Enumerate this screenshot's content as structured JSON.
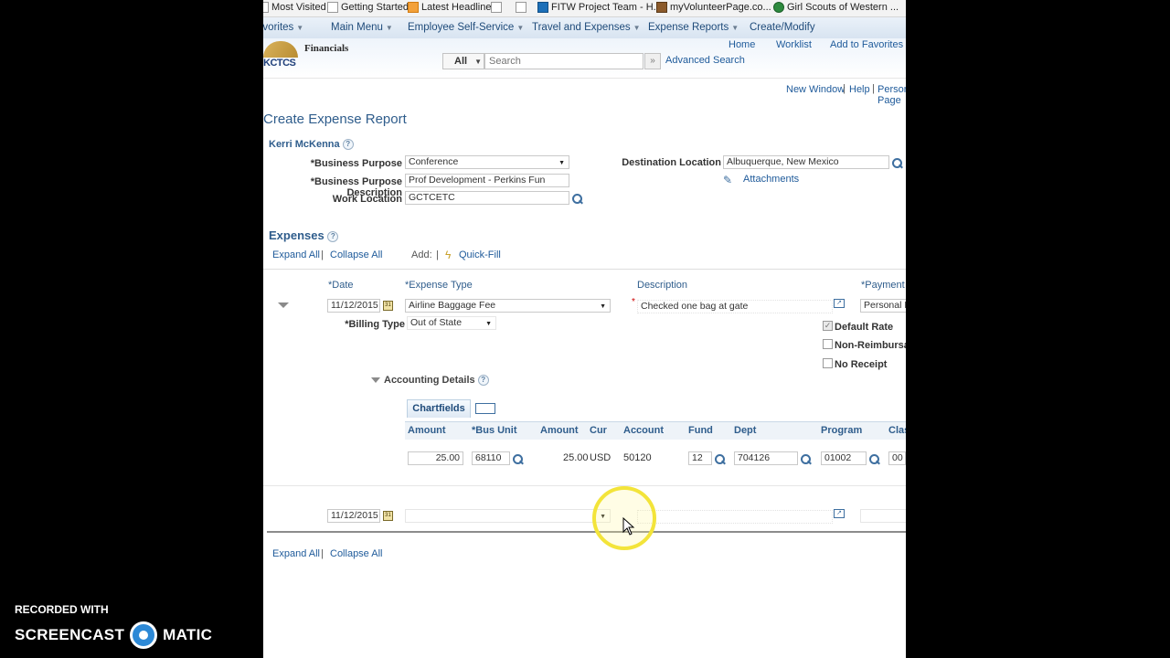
{
  "favorites_bar": [
    {
      "label": "Most Visited",
      "icon": "bookmark-icon"
    },
    {
      "label": "Getting Started",
      "icon": "page-icon"
    },
    {
      "label": "Latest Headlines",
      "icon": "rss-icon"
    },
    {
      "label": "",
      "icon": "page-icon"
    },
    {
      "label": "",
      "icon": "page-icon"
    },
    {
      "label": "FITW Project Team - H...",
      "icon": "sharepoint-icon"
    },
    {
      "label": "myVolunteerPage.co...",
      "icon": "site-icon"
    },
    {
      "label": "Girl Scouts of Western ...",
      "icon": "trefoil-icon"
    }
  ],
  "nav": {
    "favorites": "Favorites",
    "main_menu": "Main Menu",
    "self_service": "Employee Self-Service",
    "travel": "Travel and Expenses",
    "expense_reports": "Expense Reports",
    "create_modify": "Create/Modify"
  },
  "header": {
    "logo_text": "KCTCS",
    "app_name": "Financials",
    "home": "Home",
    "worklist": "Worklist",
    "add_favorites": "Add to Favorites",
    "search_scope": "All",
    "search_placeholder": "Search",
    "advanced_search": "Advanced Search"
  },
  "toolbar": {
    "new_window": "New Window",
    "help": "Help",
    "personalize": "Personalize Page"
  },
  "page": {
    "title": "Create Expense Report",
    "employee": "Kerri McKenna"
  },
  "form": {
    "business_purpose_label": "*Business Purpose",
    "business_purpose": "Conference",
    "description_label": "*Business Purpose Description",
    "description": "Prof Development - Perkins Fun",
    "work_location_label": "Work Location",
    "work_location": "GCTCETC",
    "destination_label": "Destination Location",
    "destination": "Albuquerque, New Mexico",
    "attachments": "Attachments"
  },
  "expenses": {
    "heading": "Expenses",
    "expand_all": "Expand All",
    "collapse_all": "Collapse All",
    "add_label": "Add:",
    "quick_fill": "Quick-Fill",
    "col_date": "*Date",
    "col_type": "*Expense Type",
    "col_description": "Description",
    "col_payment": "*Payment Type",
    "row1": {
      "date": "11/12/2015",
      "type": "Airline Baggage Fee",
      "description": "Checked one bag at gate",
      "payment": "Personal Funds",
      "billing_label": "*Billing Type",
      "billing": "Out of State",
      "default_rate": "Default Rate",
      "non_reimbursable": "Non-Reimbursable",
      "no_receipt": "No Receipt"
    },
    "accounting_details": "Accounting Details",
    "chartfields_tab": "Chartfields",
    "grid_headers": [
      "Amount",
      "*Bus Unit",
      "Amount",
      "Cur",
      "Account",
      "Fund",
      "Dept",
      "Program",
      "Class"
    ],
    "grid_row": {
      "amount": "25.00",
      "bus_unit": "68110",
      "amount2": "25.00",
      "currency": "USD",
      "account": "50120",
      "fund": "12",
      "dept": "704126",
      "program": "01002",
      "class": "00"
    },
    "row2": {
      "date": "11/12/2015",
      "type": "",
      "description": ""
    },
    "expand_all_bottom": "Expand All",
    "collapse_all_bottom": "Collapse All"
  },
  "watermark": {
    "line1": "RECORDED WITH",
    "brand_left": "SCREENCAST",
    "brand_right": "MATIC"
  }
}
